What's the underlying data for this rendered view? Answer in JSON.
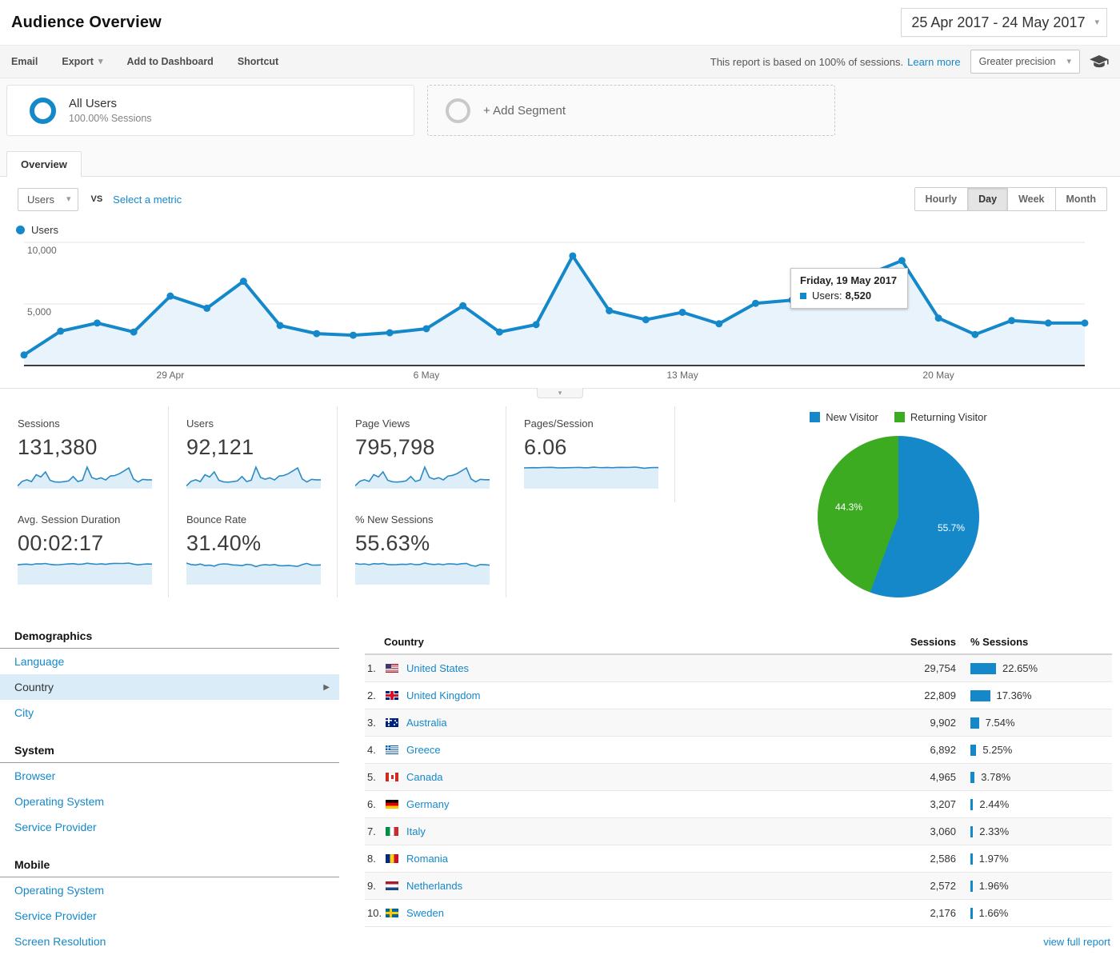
{
  "header": {
    "title": "Audience Overview",
    "date_range": "25 Apr 2017 - 24 May 2017"
  },
  "toolbar": {
    "actions": [
      "Email",
      "Export",
      "Add to Dashboard",
      "Shortcut"
    ],
    "report_basis": "This report is based on 100% of sessions.",
    "learn_more_label": "Learn more",
    "precision_label": "Greater precision"
  },
  "segments": {
    "all_users_label": "All Users",
    "all_users_sublabel": "100.00% Sessions",
    "add_segment_label": "+ Add Segment"
  },
  "tabs": {
    "overview_label": "Overview"
  },
  "controls": {
    "metric_dropdown": "Users",
    "vs_label": "VS",
    "select_metric_label": "Select a metric",
    "granularity": [
      "Hourly",
      "Day",
      "Week",
      "Month"
    ],
    "active_granularity": "Day"
  },
  "chart_legend": {
    "series_label": "Users"
  },
  "chart_data": [
    {
      "id": "users-over-time",
      "type": "line",
      "title": "Users",
      "x": [
        "25 Apr",
        "26 Apr",
        "27 Apr",
        "28 Apr",
        "29 Apr",
        "30 Apr",
        "1 May",
        "2 May",
        "3 May",
        "4 May",
        "5 May",
        "6 May",
        "7 May",
        "8 May",
        "9 May",
        "10 May",
        "11 May",
        "12 May",
        "13 May",
        "14 May",
        "15 May",
        "16 May",
        "17 May",
        "18 May",
        "19 May",
        "20 May",
        "21 May",
        "22 May",
        "23 May",
        "24 May"
      ],
      "values": [
        860,
        2790,
        3450,
        2720,
        5640,
        4650,
        6840,
        3250,
        2590,
        2460,
        2660,
        2990,
        4850,
        2720,
        3320,
        8900,
        4450,
        3720,
        4320,
        3390,
        5050,
        5310,
        6100,
        7300,
        8520,
        3850,
        2520,
        3650,
        3450,
        3450
      ],
      "tick_indices": [
        4,
        11,
        18,
        25
      ],
      "tick_labels": [
        "29 Apr",
        "6 May",
        "13 May",
        "20 May"
      ],
      "y_ticks": [
        5000,
        10000
      ],
      "y_tick_labels": [
        "5,000",
        "10,000"
      ],
      "ylim": [
        0,
        10500
      ],
      "grid": true,
      "line_color": "#1588ca",
      "fill_color": "#e9f3fb",
      "tooltip": {
        "date": "Friday, 19 May 2017",
        "label": "Users:",
        "value": "8,520",
        "index": 24
      }
    },
    {
      "id": "visitor-type",
      "type": "pie",
      "legend": [
        "New Visitor",
        "Returning Visitor"
      ],
      "values": [
        55.7,
        44.3
      ],
      "labels": [
        "55.7%",
        "44.3%"
      ],
      "colors": [
        "#1588ca",
        "#3dab21"
      ],
      "legend_position": "top"
    }
  ],
  "metrics": [
    {
      "label": "Sessions",
      "value": "131,380",
      "sparkline": [
        860,
        2790,
        3450,
        2720,
        5640,
        4650,
        6840,
        3250,
        2590,
        2460,
        2660,
        2990,
        4850,
        2720,
        3320,
        8900,
        4450,
        3720,
        4320,
        3390,
        5050,
        5310,
        6100,
        7300,
        8520,
        3850,
        2520,
        3650,
        3450,
        3450
      ]
    },
    {
      "label": "Users",
      "value": "92,121",
      "sparkline": [
        860,
        2790,
        3450,
        2720,
        5640,
        4650,
        6840,
        3250,
        2590,
        2460,
        2660,
        2990,
        4850,
        2720,
        3320,
        8900,
        4450,
        3720,
        4320,
        3390,
        5050,
        5310,
        6100,
        7300,
        8520,
        3850,
        2520,
        3650,
        3450,
        3450
      ]
    },
    {
      "label": "Page Views",
      "value": "795,798",
      "sparkline": [
        900,
        2850,
        3500,
        2800,
        5700,
        4700,
        6900,
        3300,
        2650,
        2500,
        2700,
        3050,
        4900,
        2800,
        3400,
        8950,
        4500,
        3800,
        4400,
        3450,
        5100,
        5400,
        6150,
        7350,
        8600,
        3900,
        2600,
        3700,
        3500,
        3500
      ]
    },
    {
      "label": "Pages/Session",
      "value": "6.06",
      "sparkline": [
        5.95,
        6.0,
        6.02,
        5.98,
        6.05,
        6.08,
        6.1,
        6.0,
        5.96,
        5.98,
        6.02,
        6.05,
        6.08,
        6.0,
        6.02,
        6.15,
        6.06,
        6.02,
        6.08,
        6.0,
        6.08,
        6.1,
        6.08,
        6.1,
        6.18,
        6.02,
        5.85,
        5.98,
        6.06,
        6.04
      ]
    },
    {
      "label": "Avg. Session Duration",
      "value": "00:02:17",
      "sparkline": [
        130,
        133,
        135,
        131,
        137,
        136,
        139,
        133,
        130,
        131,
        134,
        136,
        138,
        133,
        135,
        141,
        137,
        134,
        137,
        133,
        138,
        140,
        139,
        140,
        142,
        135,
        130,
        134,
        136,
        135
      ]
    },
    {
      "label": "Bounce Rate",
      "value": "31.40%",
      "sparkline": [
        33.5,
        31.2,
        30.4,
        32.0,
        29.5,
        30.2,
        28.6,
        31.4,
        32.2,
        31.8,
        30.6,
        30.2,
        29.4,
        31.5,
        30.8,
        27.8,
        30.2,
        31.0,
        30.2,
        31.2,
        29.4,
        29.2,
        29.8,
        29.0,
        28.2,
        31.0,
        33.0,
        30.4,
        30.2,
        30.6
      ]
    },
    {
      "label": "% New Sessions",
      "value": "55.63%",
      "sparkline": [
        58,
        55.5,
        56.8,
        54.2,
        57.4,
        56.2,
        58.2,
        55.0,
        54.2,
        54.8,
        55.8,
        55.2,
        57.0,
        54.4,
        55.2,
        59.0,
        56.2,
        55.0,
        56.2,
        54.4,
        57.0,
        56.4,
        55.2,
        57.2,
        58.0,
        52.4,
        50.2,
        55.0,
        54.2,
        53.2
      ]
    }
  ],
  "sidebar": {
    "sections": [
      {
        "heading": "Demographics",
        "items": [
          {
            "label": "Language",
            "selected": false
          },
          {
            "label": "Country",
            "selected": true
          },
          {
            "label": "City",
            "selected": false
          }
        ]
      },
      {
        "heading": "System",
        "items": [
          {
            "label": "Browser",
            "selected": false
          },
          {
            "label": "Operating System",
            "selected": false
          },
          {
            "label": "Service Provider",
            "selected": false
          }
        ]
      },
      {
        "heading": "Mobile",
        "items": [
          {
            "label": "Operating System",
            "selected": false
          },
          {
            "label": "Service Provider",
            "selected": false
          },
          {
            "label": "Screen Resolution",
            "selected": false
          }
        ]
      }
    ]
  },
  "country_table": {
    "headers": [
      "Country",
      "Sessions",
      "% Sessions"
    ],
    "rows": [
      {
        "rank": "1.",
        "country": "United States",
        "flag": "us",
        "sessions": "29,754",
        "pct": "22.65%",
        "pct_value": 22.65
      },
      {
        "rank": "2.",
        "country": "United Kingdom",
        "flag": "gb",
        "sessions": "22,809",
        "pct": "17.36%",
        "pct_value": 17.36
      },
      {
        "rank": "3.",
        "country": "Australia",
        "flag": "au",
        "sessions": "9,902",
        "pct": "7.54%",
        "pct_value": 7.54
      },
      {
        "rank": "4.",
        "country": "Greece",
        "flag": "gr",
        "sessions": "6,892",
        "pct": "5.25%",
        "pct_value": 5.25
      },
      {
        "rank": "5.",
        "country": "Canada",
        "flag": "ca",
        "sessions": "4,965",
        "pct": "3.78%",
        "pct_value": 3.78
      },
      {
        "rank": "6.",
        "country": "Germany",
        "flag": "de",
        "sessions": "3,207",
        "pct": "2.44%",
        "pct_value": 2.44
      },
      {
        "rank": "7.",
        "country": "Italy",
        "flag": "it",
        "sessions": "3,060",
        "pct": "2.33%",
        "pct_value": 2.33
      },
      {
        "rank": "8.",
        "country": "Romania",
        "flag": "ro",
        "sessions": "2,586",
        "pct": "1.97%",
        "pct_value": 1.97
      },
      {
        "rank": "9.",
        "country": "Netherlands",
        "flag": "nl",
        "sessions": "2,572",
        "pct": "1.96%",
        "pct_value": 1.96
      },
      {
        "rank": "10.",
        "country": "Sweden",
        "flag": "se",
        "sessions": "2,176",
        "pct": "1.66%",
        "pct_value": 1.66
      }
    ]
  },
  "footer": {
    "view_full_report_label": "view full report"
  }
}
